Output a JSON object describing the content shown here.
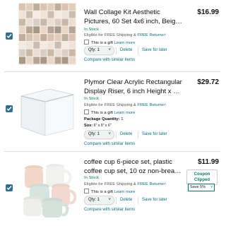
{
  "colors": {
    "checkbox": "#2F6E8E",
    "link": "#007185",
    "in_stock": "#067D62",
    "divider": "#DDDDDD"
  },
  "items": [
    {
      "title_line1": "Wall Collage Kit Aesthetic",
      "title_line2": "Pictures, 60 Set 4x6 inch, Beige…",
      "price": "$16.99",
      "stock": "In Stock",
      "ship_prefix": "Eligible for FREE Shipping &",
      "ship_link": "FREE Returns",
      "gift_text": "This is a gift",
      "gift_link": "Learn more",
      "qty": "Qty: 1",
      "delete_label": "Delete",
      "save_label": "Save for later",
      "compare_label": "Compare with similar items",
      "image_icon": "photo-collage-icon"
    },
    {
      "title_line1": "Plymor Clear Acrylic Rectangular",
      "title_line2": "Display Riser, 6 inch Height x 9 i…",
      "price": "$29.72",
      "stock": "In Stock",
      "ship_prefix": "Eligible for FREE Shipping &",
      "ship_link": "FREE Returns",
      "gift_text": "This is a gift",
      "gift_link": "Learn more",
      "package_label": "Package Quantity:",
      "package_value": "1",
      "size_label": "Size:",
      "size_value": "6\" x 9\" x 6\"",
      "qty": "Qty: 1",
      "delete_label": "Delete",
      "save_label": "Save for later",
      "compare_label": "Compare with similar items",
      "image_icon": "acrylic-riser-icon"
    },
    {
      "title_line1": "coffee cup 6-piece set, plastic",
      "title_line2": "coffee cup set, 10 oz non-break…",
      "price": "$11.99",
      "stock": "In Stock",
      "ship_prefix": "Eligible for FREE Shipping &",
      "ship_link": "FREE Returns",
      "gift_text": "This is a gift",
      "gift_link": "Learn more",
      "qty": "Qty: 1",
      "delete_label": "Delete",
      "save_label": "Save for later",
      "compare_label": "Compare with similar items",
      "coupon_line1": "Coupon",
      "coupon_line2": "Clipped",
      "coupon_select": "Save 5%",
      "image_icon": "coffee-cups-icon"
    }
  ]
}
